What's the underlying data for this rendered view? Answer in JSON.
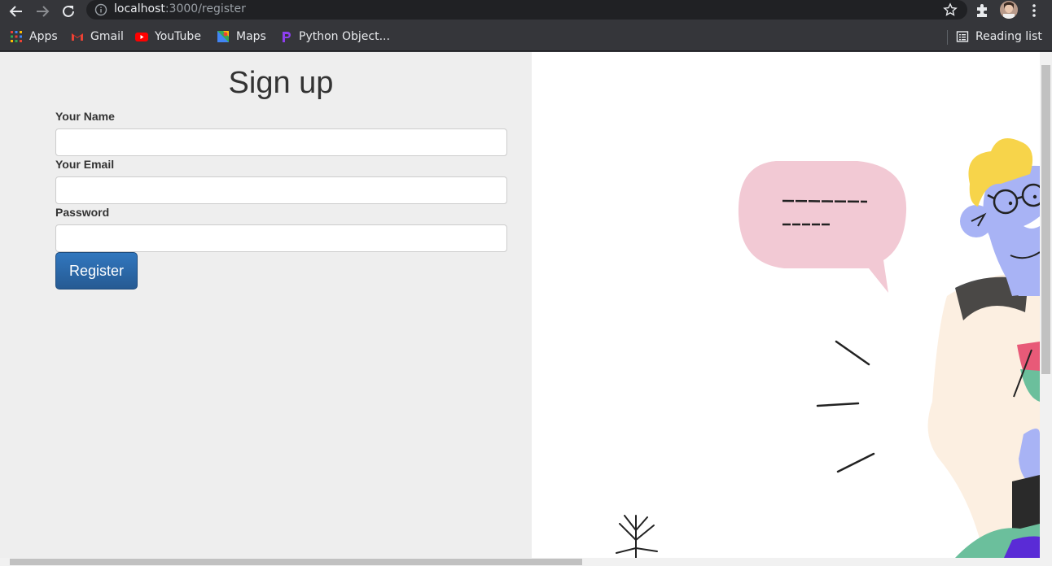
{
  "browser": {
    "url_host": "localhost",
    "url_path": ":3000/register",
    "bookmarks": [
      "Apps",
      "Gmail",
      "YouTube",
      "Maps",
      "Python Object..."
    ],
    "reading_list": "Reading list"
  },
  "form": {
    "title": "Sign up",
    "name_label": "Your Name",
    "email_label": "Your Email",
    "password_label": "Password",
    "name_value": "",
    "email_value": "",
    "password_value": "",
    "submit_label": "Register"
  },
  "colors": {
    "button": "#2b6aae",
    "left_bg": "#eeeeee",
    "bubble": "#f2c9d4",
    "hair": "#f7d44a",
    "face": "#a8b3f5"
  }
}
